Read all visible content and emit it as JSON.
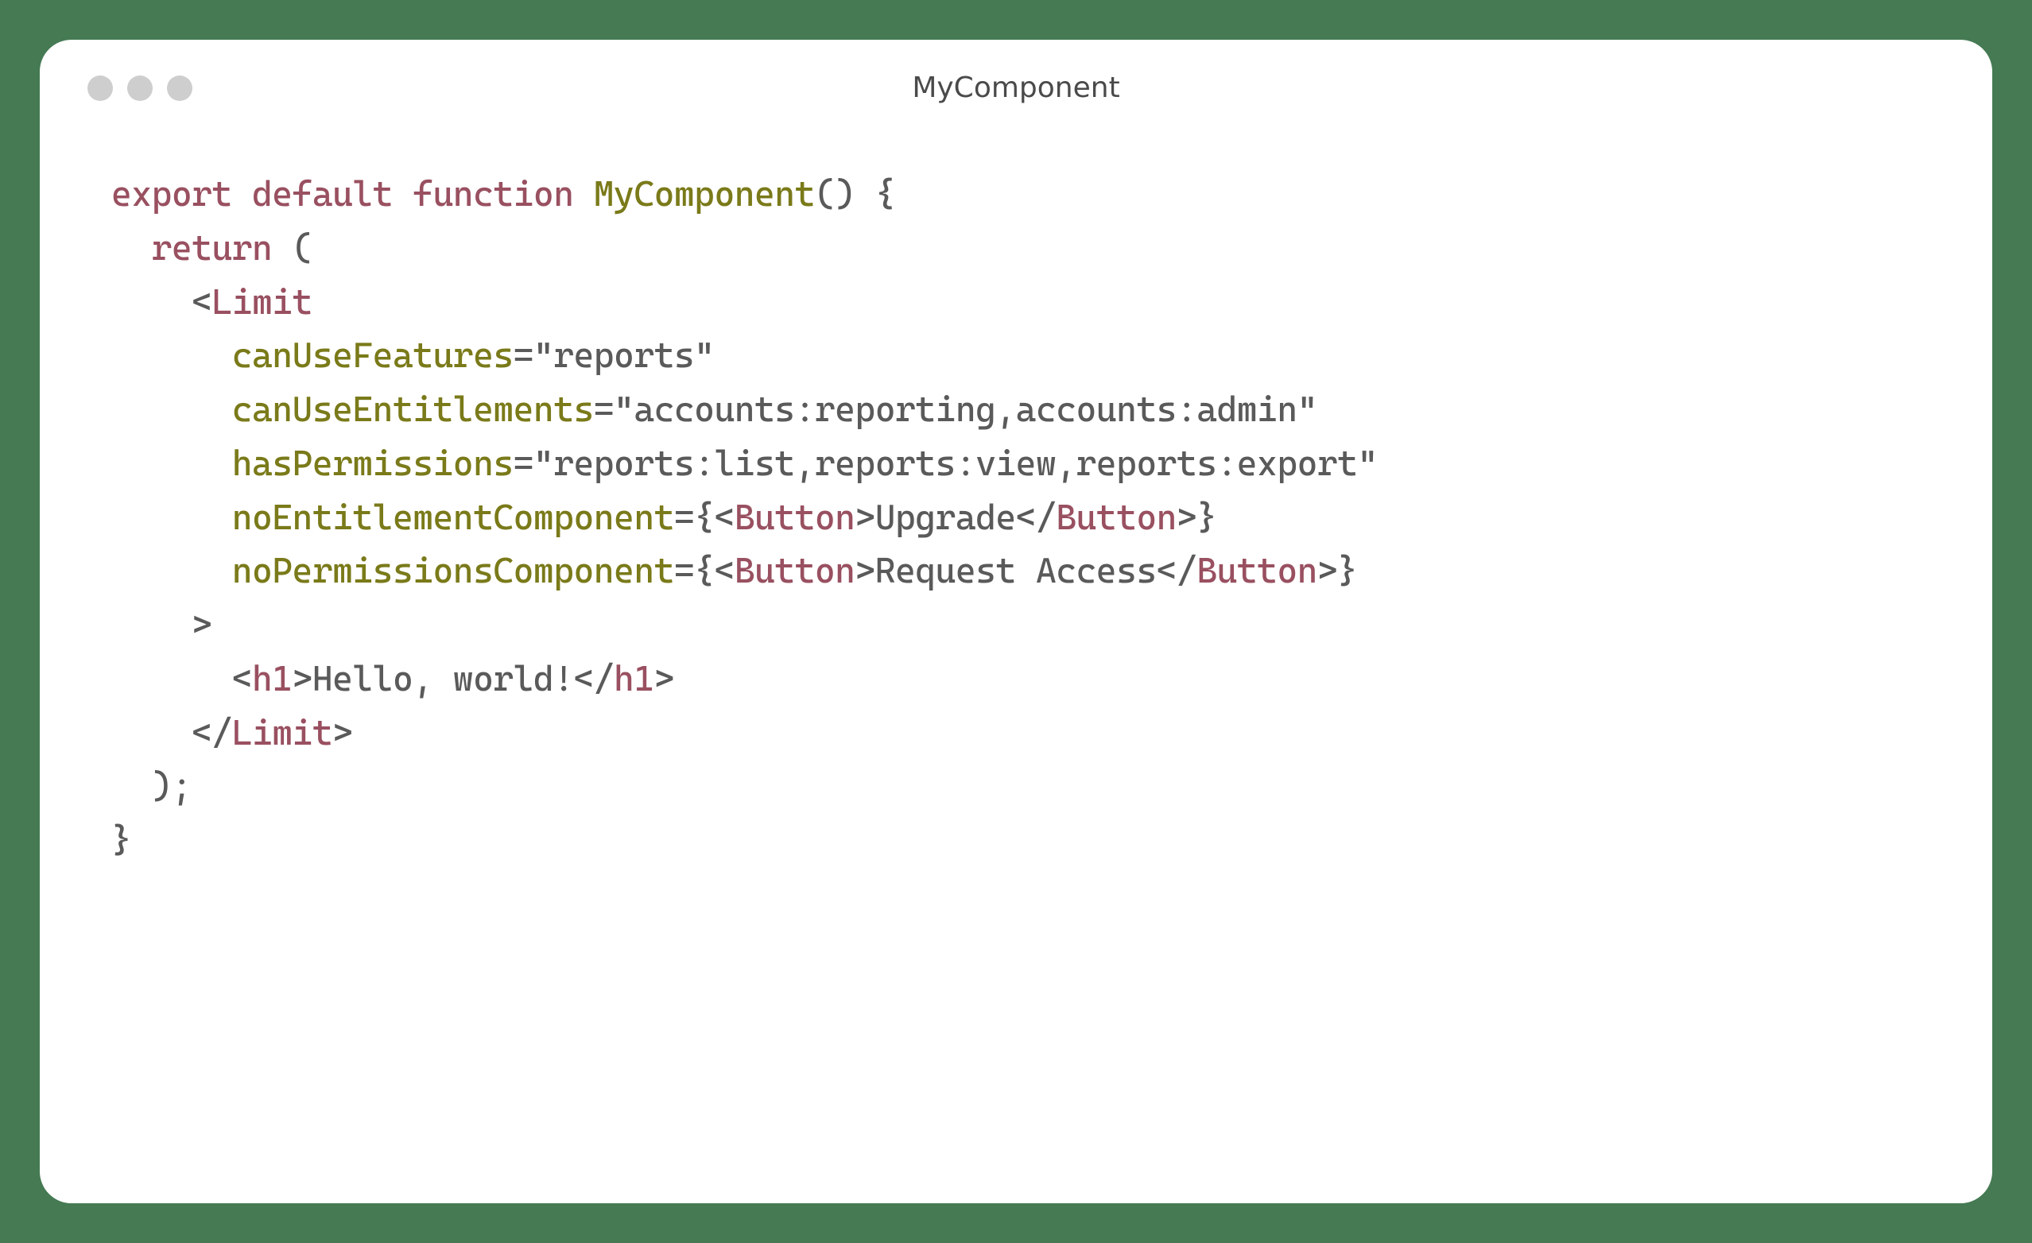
{
  "window": {
    "title": "MyComponent"
  },
  "code": {
    "tokens": {
      "export": "export",
      "default": "default",
      "function": "function",
      "funcName": "MyComponent",
      "parens": "()",
      "openBrace": " {",
      "return": "return",
      "openParen": " (",
      "limitOpen": "Limit",
      "attr1Name": "canUseFeatures",
      "attr1Value": "\"reports\"",
      "attr2Name": "canUseEntitlements",
      "attr2Value": "\"accounts:reporting,accounts:admin\"",
      "attr3Name": "hasPermissions",
      "attr3Value": "\"reports:list,reports:view,reports:export\"",
      "attr4Name": "noEntitlementComponent",
      "attr4Open": "={",
      "buttonTag": "Button",
      "btn1Text": "Upgrade",
      "attr4Close": "}",
      "attr5Name": "noPermissionsComponent",
      "attr5Open": "={",
      "btn2Text": "Request Access",
      "attr5Close": "}",
      "gt": ">",
      "h1": "h1",
      "h1Text": "Hello, world!",
      "limitClose": "Limit",
      "closeParen": ");",
      "closeBrace": "}"
    }
  }
}
